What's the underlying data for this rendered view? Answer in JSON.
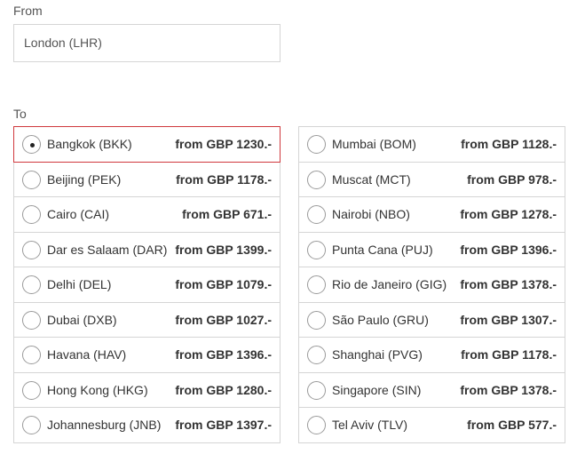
{
  "from": {
    "label": "From",
    "value": "London (LHR)"
  },
  "to": {
    "label": "To"
  },
  "destinations_left": [
    {
      "city": "Bangkok (BKK)",
      "price": "from GBP 1230.-",
      "selected": true
    },
    {
      "city": "Beijing (PEK)",
      "price": "from GBP 1178.-",
      "selected": false
    },
    {
      "city": "Cairo (CAI)",
      "price": "from GBP 671.-",
      "selected": false
    },
    {
      "city": "Dar es Salaam (DAR)",
      "price": "from GBP 1399.-",
      "selected": false
    },
    {
      "city": "Delhi (DEL)",
      "price": "from GBP 1079.-",
      "selected": false
    },
    {
      "city": "Dubai (DXB)",
      "price": "from GBP 1027.-",
      "selected": false
    },
    {
      "city": "Havana (HAV)",
      "price": "from GBP 1396.-",
      "selected": false
    },
    {
      "city": "Hong Kong (HKG)",
      "price": "from GBP 1280.-",
      "selected": false
    },
    {
      "city": "Johannesburg (JNB)",
      "price": "from GBP 1397.-",
      "selected": false
    }
  ],
  "destinations_right": [
    {
      "city": "Mumbai (BOM)",
      "price": "from GBP 1128.-",
      "selected": false
    },
    {
      "city": "Muscat (MCT)",
      "price": "from GBP 978.-",
      "selected": false
    },
    {
      "city": "Nairobi (NBO)",
      "price": "from GBP 1278.-",
      "selected": false
    },
    {
      "city": "Punta Cana (PUJ)",
      "price": "from GBP 1396.-",
      "selected": false
    },
    {
      "city": "Rio de Janeiro (GIG)",
      "price": "from GBP 1378.-",
      "selected": false
    },
    {
      "city": "São Paulo (GRU)",
      "price": "from GBP 1307.-",
      "selected": false
    },
    {
      "city": "Shanghai (PVG)",
      "price": "from GBP 1178.-",
      "selected": false
    },
    {
      "city": "Singapore (SIN)",
      "price": "from GBP 1378.-",
      "selected": false
    },
    {
      "city": "Tel Aviv (TLV)",
      "price": "from GBP 577.-",
      "selected": false
    }
  ],
  "colors": {
    "selected_border": "#d0393d",
    "border": "#d5d5d5",
    "text": "#333333"
  }
}
